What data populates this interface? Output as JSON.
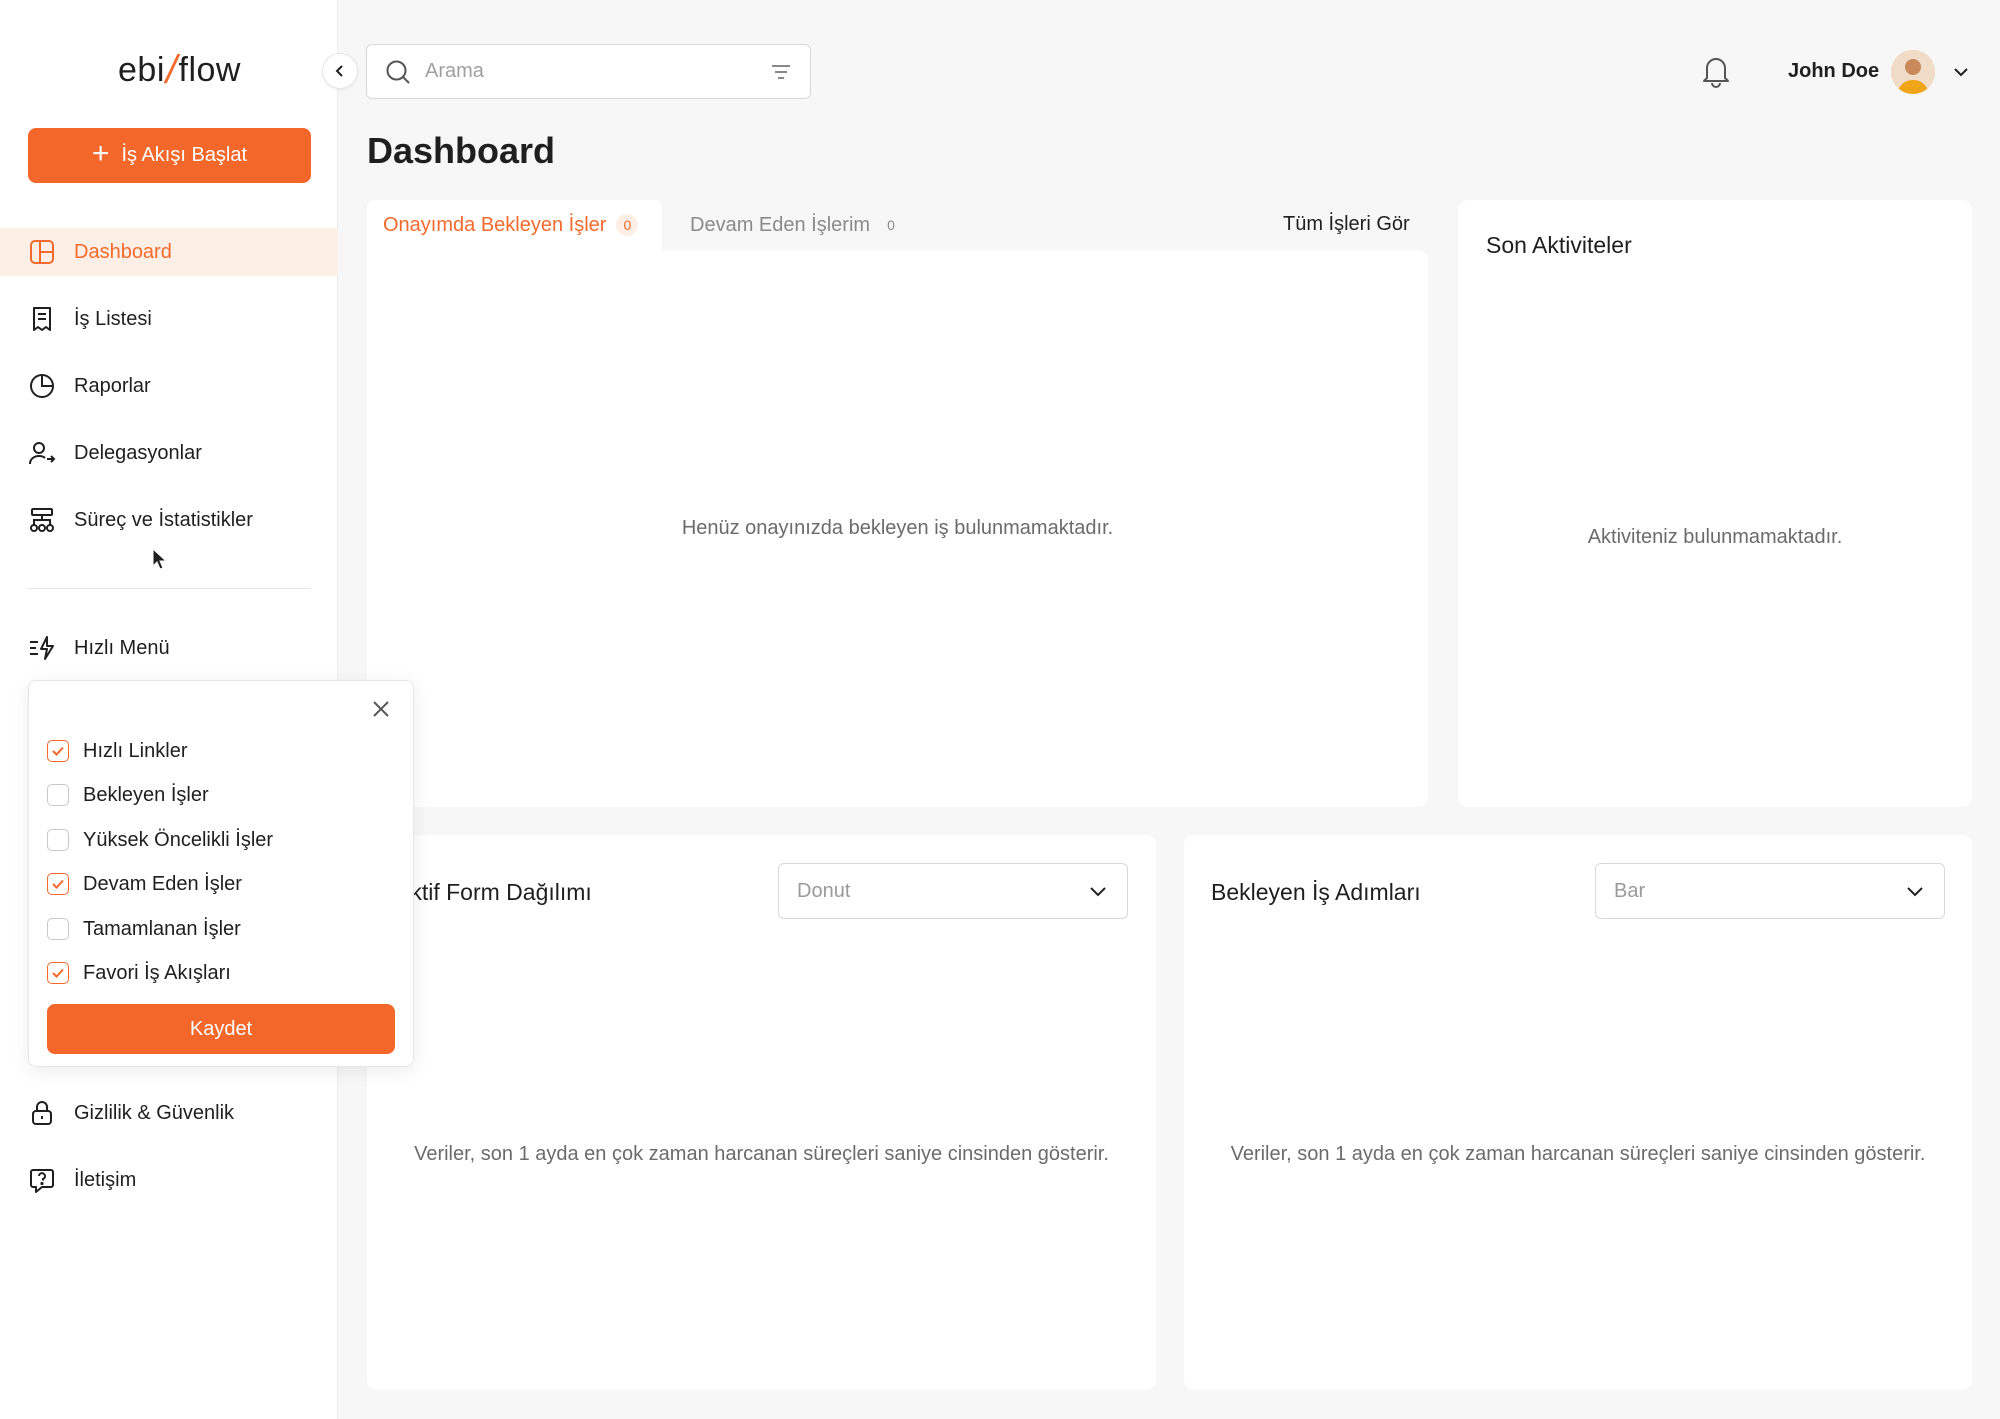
{
  "sidebar": {
    "logo": {
      "left": "ebi",
      "right": "flow"
    },
    "start_button": "İş Akışı Başlat",
    "items": [
      {
        "label": "Dashboard",
        "icon": "dashboard-icon"
      },
      {
        "label": "İş Listesi",
        "icon": "task-list-icon"
      },
      {
        "label": "Raporlar",
        "icon": "pie-chart-icon"
      },
      {
        "label": "Delegasyonlar",
        "icon": "users-delegate-icon"
      },
      {
        "label": "Süreç ve İstatistikler",
        "icon": "process-stats-icon"
      },
      {
        "label": "Hızlı Menü",
        "icon": "quick-menu-icon"
      },
      {
        "label": "Gizlilik & Güvenlik",
        "icon": "lock-icon"
      },
      {
        "label": "İletişim",
        "icon": "help-chat-icon"
      }
    ]
  },
  "quick_menu": {
    "options": [
      {
        "label": "Hızlı Linkler",
        "checked": true
      },
      {
        "label": "Bekleyen İşler",
        "checked": false
      },
      {
        "label": "Yüksek Öncelikli İşler",
        "checked": false
      },
      {
        "label": "Devam Eden İşler",
        "checked": true
      },
      {
        "label": "Tamamlanan İşler",
        "checked": false
      },
      {
        "label": "Favori İş Akışları",
        "checked": true
      }
    ],
    "save_label": "Kaydet"
  },
  "header": {
    "search_placeholder": "Arama",
    "user_name": "John Doe"
  },
  "page": {
    "title": "Dashboard",
    "tabs": [
      {
        "label": "Onayımda Bekleyen İşler",
        "count": "0"
      },
      {
        "label": "Devam Eden İşlerim",
        "count": "0"
      }
    ],
    "see_all": "Tüm İşleri Gör",
    "pending_empty": "Henüz onayınızda bekleyen iş bulunmamaktadır.",
    "activities": {
      "title": "Son Aktiviteler",
      "empty": "Aktiviteniz bulunmamaktadır."
    },
    "form_distribution": {
      "title": "Aktif Form Dağılımı",
      "select_value": "Donut",
      "note": "Veriler, son 1 ayda en çok zaman harcanan süreçleri saniye cinsinden gösterir."
    },
    "pending_steps": {
      "title": "Bekleyen İş Adımları",
      "select_value": "Bar",
      "note": "Veriler, son 1 ayda en çok zaman harcanan süreçleri saniye cinsinden gösterir."
    }
  },
  "colors": {
    "accent": "#f4672a",
    "accent_soft": "#fdeee6"
  }
}
